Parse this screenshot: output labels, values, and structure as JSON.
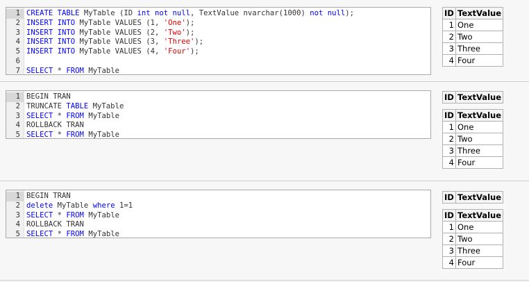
{
  "sections": [
    {
      "lines": [
        {
          "num": "1",
          "tokens": [
            [
              "kw",
              "CREATE TABLE"
            ],
            [
              "plain",
              " MyTable (ID "
            ],
            [
              "kw",
              "int not null"
            ],
            [
              "plain",
              ", TextValue nvarchar(1000) "
            ],
            [
              "kw",
              "not null"
            ],
            [
              "plain",
              ");"
            ]
          ]
        },
        {
          "num": "2",
          "tokens": [
            [
              "kw",
              "INSERT INTO"
            ],
            [
              "plain",
              " MyTable VALUES (1, "
            ],
            [
              "str",
              "'One'"
            ],
            [
              "plain",
              ");"
            ]
          ]
        },
        {
          "num": "3",
          "tokens": [
            [
              "kw",
              "INSERT INTO"
            ],
            [
              "plain",
              " MyTable VALUES (2, "
            ],
            [
              "str",
              "'Two'"
            ],
            [
              "plain",
              ");"
            ]
          ]
        },
        {
          "num": "4",
          "tokens": [
            [
              "kw",
              "INSERT INTO"
            ],
            [
              "plain",
              " MyTable VALUES (3, "
            ],
            [
              "str",
              "'Three'"
            ],
            [
              "plain",
              ");"
            ]
          ]
        },
        {
          "num": "5",
          "tokens": [
            [
              "kw",
              "INSERT INTO"
            ],
            [
              "plain",
              " MyTable VALUES (4, "
            ],
            [
              "str",
              "'Four'"
            ],
            [
              "plain",
              ");"
            ]
          ]
        },
        {
          "num": "6",
          "tokens": []
        },
        {
          "num": "7",
          "tokens": [
            [
              "kw",
              "SELECT"
            ],
            [
              "plain",
              " * "
            ],
            [
              "kw",
              "FROM"
            ],
            [
              "plain",
              " MyTable"
            ]
          ]
        }
      ],
      "result_tables": [
        {
          "headers": [
            "ID",
            "TextValue"
          ],
          "rows": [
            [
              "1",
              "One"
            ],
            [
              "2",
              "Two"
            ],
            [
              "3",
              "Three"
            ],
            [
              "4",
              "Four"
            ]
          ]
        }
      ]
    },
    {
      "lines": [
        {
          "num": "1",
          "tokens": [
            [
              "plain",
              "BEGIN TRAN"
            ]
          ]
        },
        {
          "num": "2",
          "tokens": [
            [
              "plain",
              "TRUNCATE "
            ],
            [
              "kw",
              "TABLE"
            ],
            [
              "plain",
              " MyTable"
            ]
          ]
        },
        {
          "num": "3",
          "tokens": [
            [
              "kw",
              "SELECT"
            ],
            [
              "plain",
              " * "
            ],
            [
              "kw",
              "FROM"
            ],
            [
              "plain",
              " MyTable"
            ]
          ]
        },
        {
          "num": "4",
          "tokens": [
            [
              "plain",
              "ROLLBACK TRAN"
            ]
          ]
        },
        {
          "num": "5",
          "tokens": [
            [
              "kw",
              "SELECT"
            ],
            [
              "plain",
              " * "
            ],
            [
              "kw",
              "FROM"
            ],
            [
              "plain",
              " MyTable"
            ]
          ]
        }
      ],
      "result_tables": [
        {
          "headers": [
            "ID",
            "TextValue"
          ],
          "rows": []
        },
        {
          "headers": [
            "ID",
            "TextValue"
          ],
          "rows": [
            [
              "1",
              "One"
            ],
            [
              "2",
              "Two"
            ],
            [
              "3",
              "Three"
            ],
            [
              "4",
              "Four"
            ]
          ]
        }
      ]
    },
    {
      "lines": [
        {
          "num": "1",
          "tokens": [
            [
              "plain",
              "BEGIN TRAN"
            ]
          ]
        },
        {
          "num": "2",
          "tokens": [
            [
              "kw",
              "delete"
            ],
            [
              "plain",
              " MyTable "
            ],
            [
              "kw",
              "where"
            ],
            [
              "plain",
              " 1=1"
            ]
          ]
        },
        {
          "num": "3",
          "tokens": [
            [
              "kw",
              "SELECT"
            ],
            [
              "plain",
              " * "
            ],
            [
              "kw",
              "FROM"
            ],
            [
              "plain",
              " MyTable"
            ]
          ]
        },
        {
          "num": "4",
          "tokens": [
            [
              "plain",
              "ROLLBACK TRAN"
            ]
          ]
        },
        {
          "num": "5",
          "tokens": [
            [
              "kw",
              "SELECT"
            ],
            [
              "plain",
              " * "
            ],
            [
              "kw",
              "FROM"
            ],
            [
              "plain",
              " MyTable"
            ]
          ]
        }
      ],
      "result_tables": [
        {
          "headers": [
            "ID",
            "TextValue"
          ],
          "rows": []
        },
        {
          "headers": [
            "ID",
            "TextValue"
          ],
          "rows": [
            [
              "1",
              "One"
            ],
            [
              "2",
              "Two"
            ],
            [
              "3",
              "Three"
            ],
            [
              "4",
              "Four"
            ]
          ]
        }
      ]
    }
  ]
}
